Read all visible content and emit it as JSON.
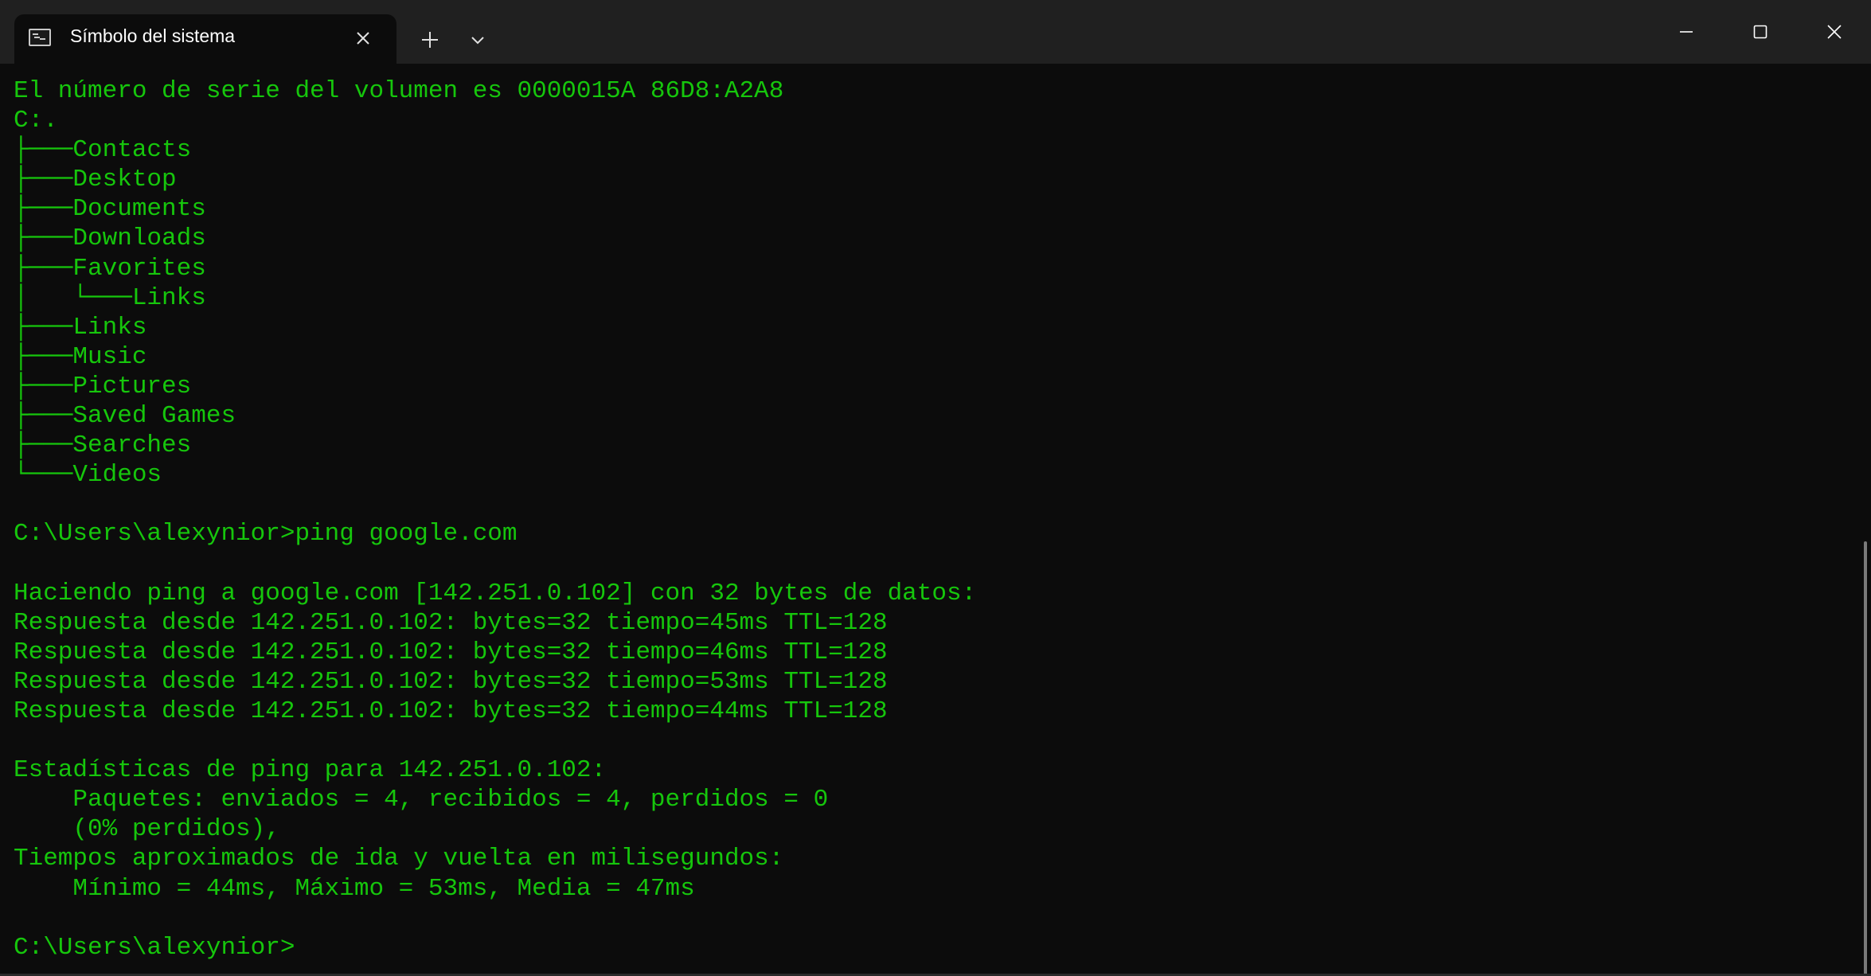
{
  "window": {
    "tab_title": "Símbolo del sistema",
    "icons": {
      "tab": "terminal-icon",
      "tab_close": "close-icon",
      "new_tab": "plus-icon",
      "dropdown": "chevron-down-icon",
      "minimize": "minimize-icon",
      "maximize": "maximize-icon",
      "close": "close-icon"
    }
  },
  "colors": {
    "terminal_bg": "#0c0c0c",
    "terminal_fg": "#16c60c",
    "titlebar_bg": "#202020",
    "tab_bg": "#0c0c0c"
  },
  "terminal": {
    "lines": [
      "El número de serie del volumen es 0000015A 86D8:A2A8",
      "C:.",
      "├───Contacts",
      "├───Desktop",
      "├───Documents",
      "├───Downloads",
      "├───Favorites",
      "│   └───Links",
      "├───Links",
      "├───Music",
      "├───Pictures",
      "├───Saved Games",
      "├───Searches",
      "└───Videos",
      "",
      "C:\\Users\\alexynior>ping google.com",
      "",
      "Haciendo ping a google.com [142.251.0.102] con 32 bytes de datos:",
      "Respuesta desde 142.251.0.102: bytes=32 tiempo=45ms TTL=128",
      "Respuesta desde 142.251.0.102: bytes=32 tiempo=46ms TTL=128",
      "Respuesta desde 142.251.0.102: bytes=32 tiempo=53ms TTL=128",
      "Respuesta desde 142.251.0.102: bytes=32 tiempo=44ms TTL=128",
      "",
      "Estadísticas de ping para 142.251.0.102:",
      "    Paquetes: enviados = 4, recibidos = 4, perdidos = 0",
      "    (0% perdidos),",
      "Tiempos aproximados de ida y vuelta en milisegundos:",
      "    Mínimo = 44ms, Máximo = 53ms, Media = 47ms",
      "",
      "C:\\Users\\alexynior>"
    ]
  }
}
